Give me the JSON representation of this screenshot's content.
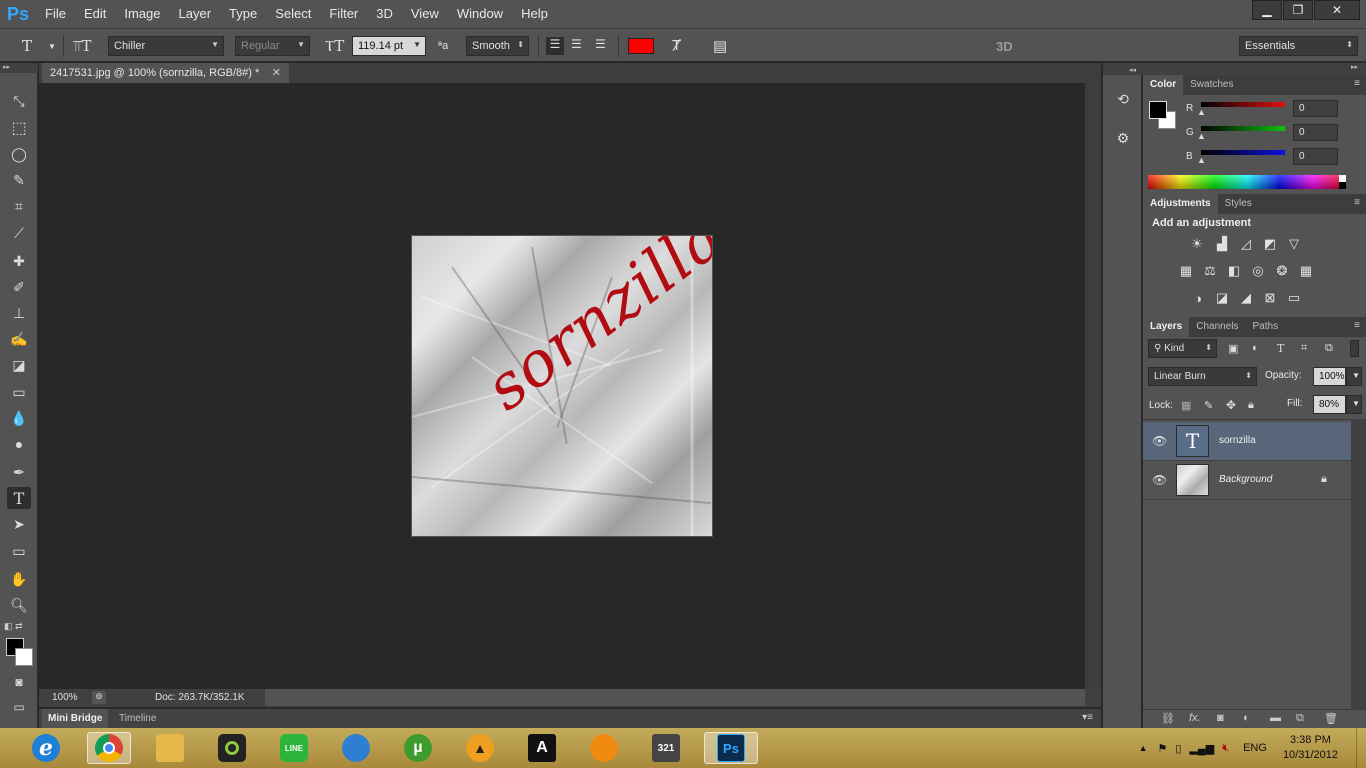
{
  "app": {
    "logo": "Ps"
  },
  "menu": [
    "File",
    "Edit",
    "Image",
    "Layer",
    "Type",
    "Select",
    "Filter",
    "3D",
    "View",
    "Window",
    "Help"
  ],
  "window_controls": {
    "minimize": "▁",
    "restore": "❐",
    "close": "✕"
  },
  "options": {
    "font_family": "Chiller",
    "font_style": "Regular",
    "font_size": "119.14 pt",
    "antialias": "Smooth",
    "text_color": "#ff0000",
    "mode_3d": "3D",
    "workspace": "Essentials"
  },
  "document": {
    "tab_title": "2417531.jpg @ 100% (sornzilla, RGB/8#) *",
    "canvas_text": "sornzilla",
    "text_color": "#b00c12"
  },
  "status": {
    "zoom": "100%",
    "doc_size": "Doc: 263.7K/352.1K"
  },
  "bottom_tabs": [
    "Mini Bridge",
    "Timeline"
  ],
  "color_panel": {
    "tabs": [
      "Color",
      "Swatches"
    ],
    "channels": [
      {
        "label": "R",
        "value": "0",
        "color": "#e01010"
      },
      {
        "label": "G",
        "value": "0",
        "color": "#10c010"
      },
      {
        "label": "B",
        "value": "0",
        "color": "#1010e0"
      }
    ]
  },
  "adjustments_panel": {
    "tabs": [
      "Adjustments",
      "Styles"
    ],
    "heading": "Add an adjustment",
    "icons": [
      [
        "brightness-icon",
        "levels-icon",
        "curves-icon",
        "exposure-icon",
        "vibrance-icon"
      ],
      [
        "hue-icon",
        "color-balance-icon",
        "black-white-icon",
        "photo-filter-icon",
        "channel-mixer-icon",
        "color-lookup-icon"
      ],
      [
        "invert-icon",
        "posterize-icon",
        "threshold-icon",
        "selective-color-icon",
        "gradient-map-icon"
      ]
    ]
  },
  "layers_panel": {
    "tabs": [
      "Layers",
      "Channels",
      "Paths"
    ],
    "filter_kind": "Kind",
    "blend_mode": "Linear Burn",
    "opacity_label": "Opacity:",
    "opacity": "100%",
    "lock_label": "Lock:",
    "fill_label": "Fill:",
    "fill": "80%",
    "layers": [
      {
        "name": "sornzilla",
        "type": "text",
        "selected": true
      },
      {
        "name": "Background",
        "type": "image",
        "locked": true
      }
    ],
    "footer_icons": [
      "link-icon",
      "fx-icon",
      "mask-icon",
      "adjustment-layer-icon",
      "group-icon",
      "new-layer-icon",
      "trash-icon"
    ]
  },
  "taskbar": {
    "apps": [
      {
        "name": "ie-icon",
        "label": "e",
        "color": "#1e7fd6"
      },
      {
        "name": "chrome-icon",
        "label": "",
        "color": "#dd3b2a"
      },
      {
        "name": "explorer-icon",
        "label": "",
        "color": "#e6b84a"
      },
      {
        "name": "camera-app-icon",
        "label": "",
        "color": "#222222"
      },
      {
        "name": "line-icon",
        "label": "LINE",
        "color": "#2bb53b"
      },
      {
        "name": "globe-app-icon",
        "label": "",
        "color": "#2f7fd0"
      },
      {
        "name": "utorrent-icon",
        "label": "µ",
        "color": "#3e9b2e"
      },
      {
        "name": "aimp-icon",
        "label": "",
        "color": "#f0a020"
      },
      {
        "name": "ai-app-icon",
        "label": "A",
        "color": "#111111"
      },
      {
        "name": "orange-app-icon",
        "label": "",
        "color": "#f08a10"
      },
      {
        "name": "media-player-icon",
        "label": "321",
        "color": "#444444"
      },
      {
        "name": "photoshop-task-icon",
        "label": "Ps",
        "color": "#0c2a4a"
      }
    ],
    "language": "ENG",
    "time": "3:38 PM",
    "date": "10/31/2012"
  }
}
